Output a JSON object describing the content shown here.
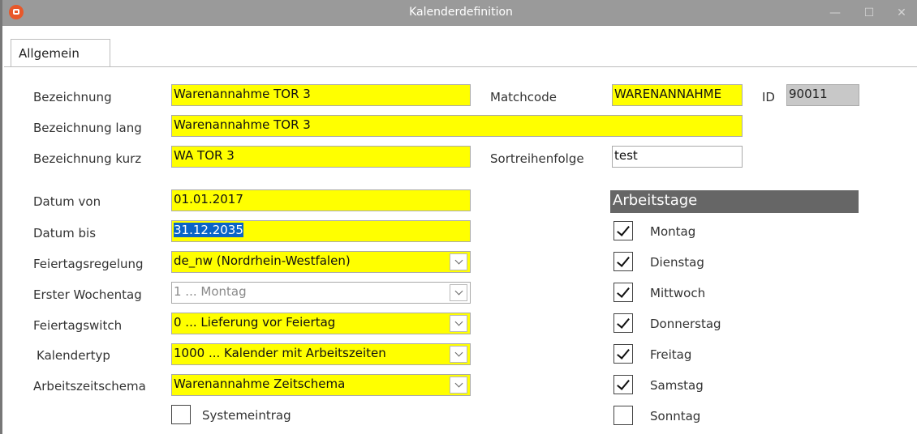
{
  "window": {
    "title": "Kalenderdefinition",
    "icon": "app-logo-icon",
    "controls": {
      "minimize": "—",
      "maximize": "☐",
      "close": "✕"
    }
  },
  "tabs": [
    {
      "label": "Allgemein",
      "active": true
    }
  ],
  "form": {
    "bezeichnung": {
      "label": "Bezeichnung",
      "value": "Warenannahme TOR 3"
    },
    "matchcode": {
      "label": "Matchcode",
      "value": "WARENANNAHME"
    },
    "id": {
      "label": "ID",
      "value": "90011"
    },
    "bezeichnung_lang": {
      "label": "Bezeichnung lang",
      "value": "Warenannahme TOR 3"
    },
    "bezeichnung_kurz": {
      "label": "Bezeichnung kurz",
      "value": "WA TOR 3"
    },
    "sortreihenfolge": {
      "label": "Sortreihenfolge",
      "value": "test"
    },
    "datum_von": {
      "label": "Datum von",
      "value": "01.01.2017"
    },
    "datum_bis": {
      "label": "Datum bis",
      "value": "31.12.2035"
    },
    "feiertagsregelung": {
      "label": "Feiertagsregelung",
      "value": "de_nw (Nordrhein-Westfalen)"
    },
    "erster_wochentag": {
      "label": "Erster Wochentag",
      "value": "1 ... Montag"
    },
    "feiertagswitch": {
      "label": "Feiertagswitch",
      "value": "0 ... Lieferung vor Feiertag"
    },
    "kalendertyp": {
      "label": "Kalendertyp",
      "value": "1000 ... Kalender mit Arbeitszeiten"
    },
    "arbeitszeitschema": {
      "label": "Arbeitszeitschema",
      "value": "Warenannahme Zeitschema"
    },
    "systemeintrag": {
      "label": "Systemeintrag",
      "checked": false
    }
  },
  "arbeitstage": {
    "title": "Arbeitstage",
    "days": [
      {
        "label": "Montag",
        "checked": true
      },
      {
        "label": "Dienstag",
        "checked": true
      },
      {
        "label": "Mittwoch",
        "checked": true
      },
      {
        "label": "Donnerstag",
        "checked": true
      },
      {
        "label": "Freitag",
        "checked": true
      },
      {
        "label": "Samstag",
        "checked": true
      },
      {
        "label": "Sonntag",
        "checked": false
      }
    ]
  },
  "colors": {
    "required": "#ffff00",
    "titlebar": "#9a9a9a",
    "section_header": "#666666",
    "selection": "#0a64c8"
  }
}
